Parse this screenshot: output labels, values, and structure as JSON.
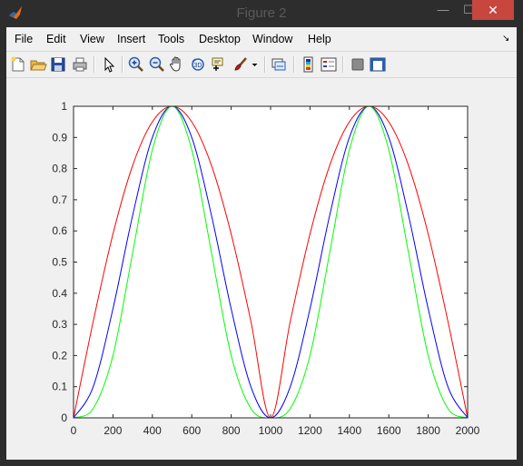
{
  "window": {
    "title": "Figure 2",
    "controls": {
      "minimize": "—",
      "maximize": "☐",
      "close": "✕"
    }
  },
  "menu": {
    "items": [
      "File",
      "Edit",
      "View",
      "Insert",
      "Tools",
      "Desktop",
      "Window",
      "Help"
    ],
    "dock_glyph": "↘"
  },
  "toolbar": {
    "icons": [
      "new-figure-icon",
      "open-file-icon",
      "save-icon",
      "print-icon",
      "pointer-arrow-icon",
      "zoom-in-icon",
      "zoom-out-icon",
      "pan-hand-icon",
      "rotate-3d-icon",
      "data-cursor-icon",
      "brush-icon",
      "link-plot-icon",
      "colorbar-icon",
      "legend-icon",
      "hide-plot-tools-icon",
      "show-plot-tools-icon"
    ]
  },
  "chart_data": {
    "type": "line",
    "title": "",
    "xlabel": "",
    "ylabel": "",
    "xlim": [
      0,
      2000
    ],
    "ylim": [
      0,
      1
    ],
    "xticks": [
      "0",
      "200",
      "400",
      "600",
      "800",
      "1000",
      "1200",
      "1400",
      "1600",
      "1800",
      "2000"
    ],
    "yticks": [
      "0",
      "0.1",
      "0.2",
      "0.3",
      "0.4",
      "0.5",
      "0.6",
      "0.7",
      "0.8",
      "0.9",
      "1"
    ],
    "grid": false,
    "legend": "none",
    "x": [
      0,
      100,
      200,
      300,
      400,
      500,
      600,
      700,
      800,
      900,
      1000,
      1100,
      1200,
      1300,
      1400,
      1500,
      1600,
      1700,
      1800,
      1900,
      2000
    ],
    "series": [
      {
        "color": "#ff0000",
        "values": [
          0,
          0.31,
          0.59,
          0.81,
          0.95,
          1,
          0.95,
          0.81,
          0.59,
          0.31,
          0,
          0.31,
          0.59,
          0.81,
          0.95,
          1,
          0.95,
          0.81,
          0.59,
          0.31,
          0
        ]
      },
      {
        "color": "#0000ff",
        "values": [
          0,
          0.1,
          0.35,
          0.65,
          0.9,
          1,
          0.9,
          0.65,
          0.35,
          0.1,
          0,
          0.1,
          0.35,
          0.65,
          0.9,
          1,
          0.9,
          0.65,
          0.35,
          0.1,
          0
        ]
      },
      {
        "color": "#00ff00",
        "values": [
          0,
          0.03,
          0.2,
          0.53,
          0.86,
          1,
          0.86,
          0.53,
          0.2,
          0.03,
          0,
          0.03,
          0.2,
          0.53,
          0.86,
          1,
          0.86,
          0.53,
          0.2,
          0.03,
          0
        ]
      }
    ]
  }
}
